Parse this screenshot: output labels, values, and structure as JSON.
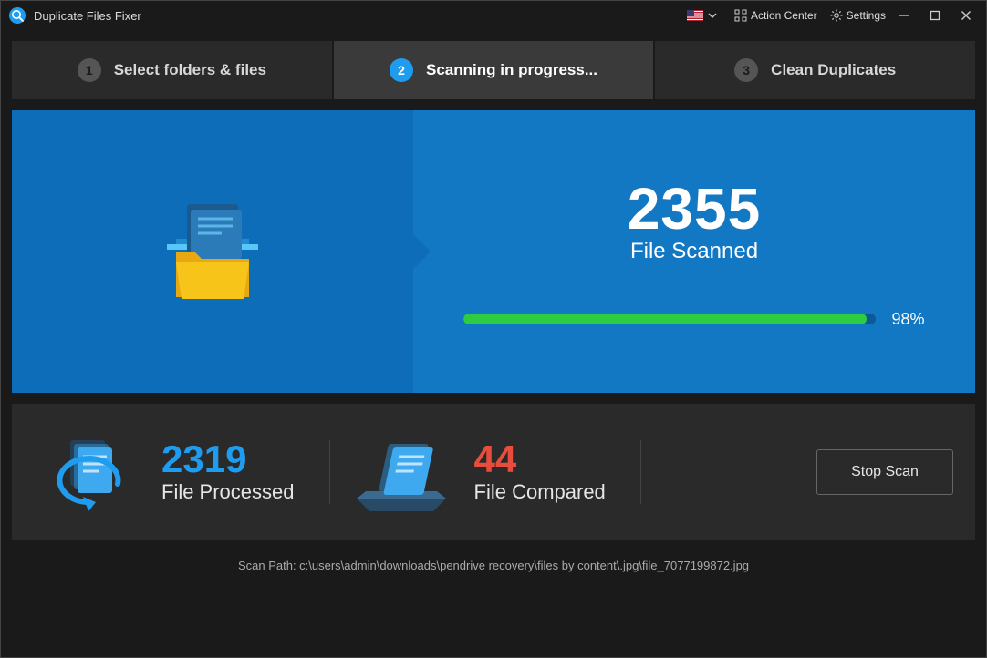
{
  "app": {
    "title": "Duplicate Files Fixer"
  },
  "titlebar": {
    "action_center": "Action Center",
    "settings": "Settings"
  },
  "steps": {
    "s1": {
      "num": "1",
      "label": "Select folders & files"
    },
    "s2": {
      "num": "2",
      "label": "Scanning in progress..."
    },
    "s3": {
      "num": "3",
      "label": "Clean Duplicates"
    }
  },
  "scan": {
    "count": "2355",
    "count_label": "File Scanned",
    "progress_pct": "98",
    "progress_pct_display": "98%"
  },
  "stats": {
    "processed": {
      "value": "2319",
      "label": "File Processed"
    },
    "compared": {
      "value": "44",
      "label": "File Compared"
    },
    "stop_label": "Stop Scan"
  },
  "path": {
    "prefix": "Scan Path: ",
    "value": "c:\\users\\admin\\downloads\\pendrive recovery\\files by content\\.jpg\\file_7077199872.jpg"
  }
}
